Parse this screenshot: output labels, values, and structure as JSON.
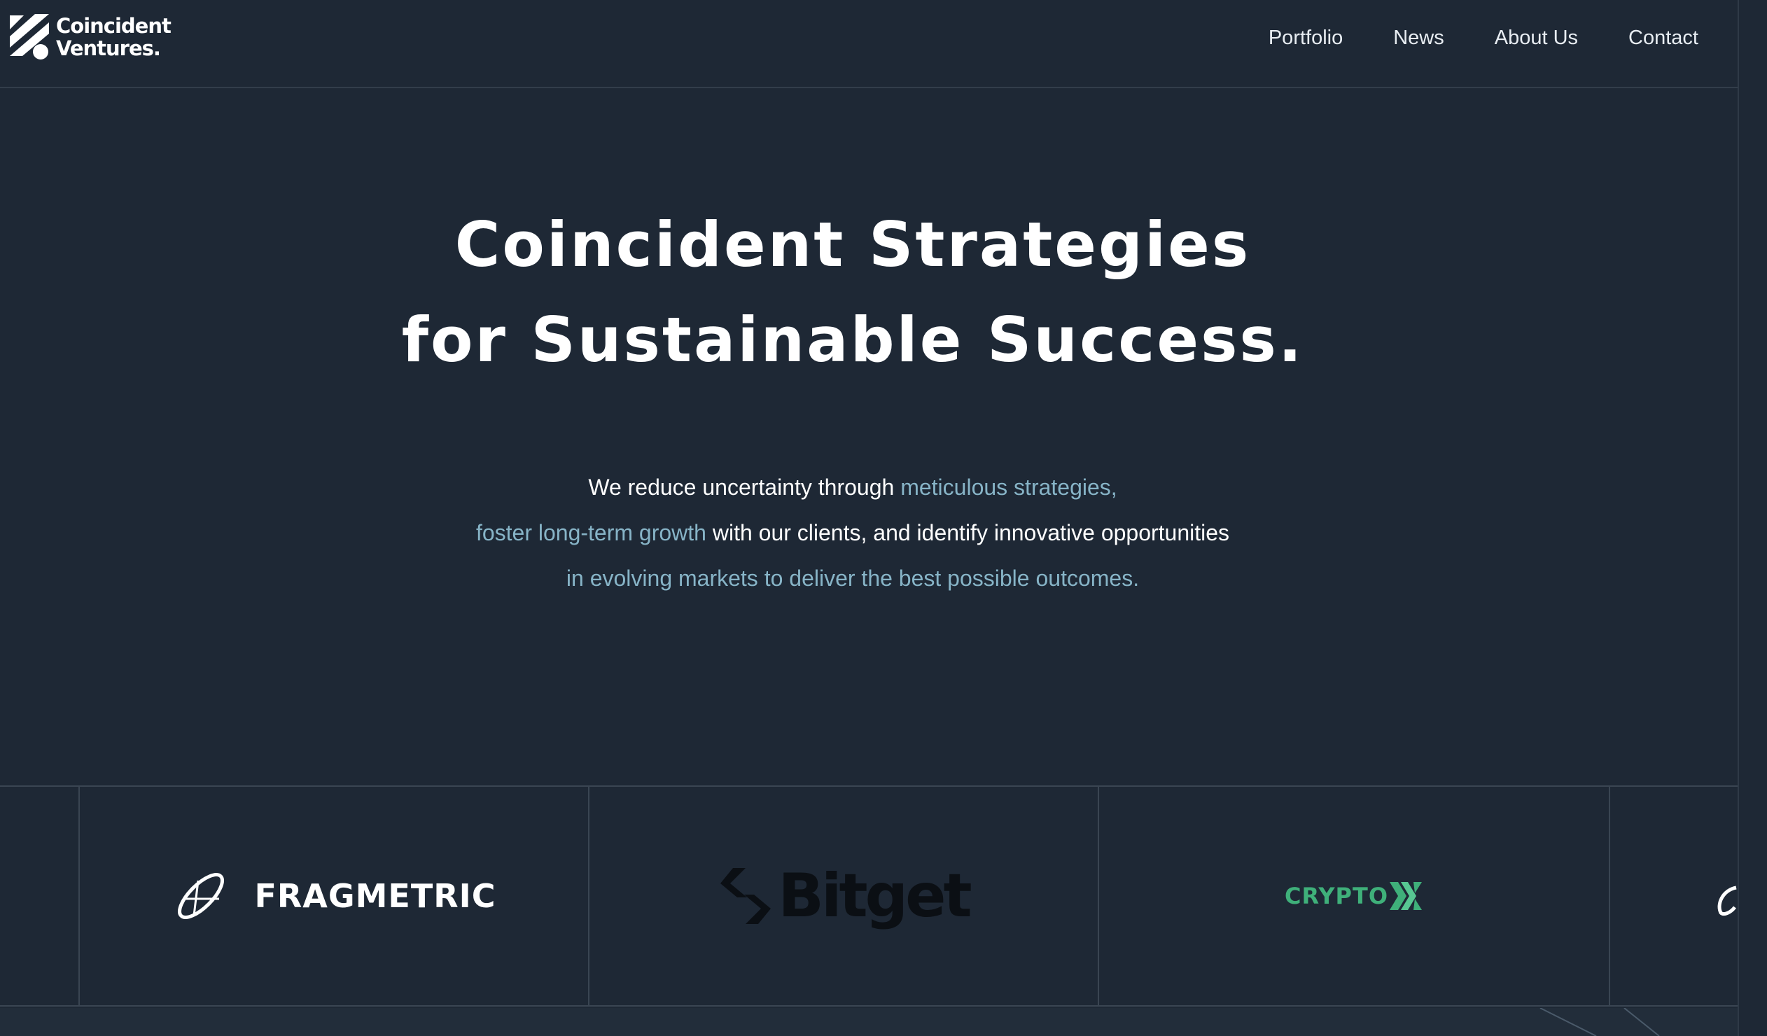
{
  "header": {
    "logo_line1": "Coincident",
    "logo_line2": "Ventures.",
    "nav": [
      "Portfolio",
      "News",
      "About Us",
      "Contact"
    ]
  },
  "hero": {
    "title_line1": "Coincident Strategies",
    "title_line2": "for Sustainable Success.",
    "sub": {
      "l1_a": "We reduce uncertainty through ",
      "l1_b": "meticulous strategies,",
      "l2_a": "foster long-term growth",
      "l2_b": " with our clients, and identify innovative opportunities",
      "l3": "in evolving markets to deliver the best possible outcomes."
    }
  },
  "partners": {
    "fragmetric": "FRAGMETRIC",
    "bitget": "Bitget",
    "cryptox": "CRYPTO"
  },
  "colors": {
    "background": "#1e2835",
    "accent_text": "#87b4c7",
    "cryptox_green": "#3fb07a"
  }
}
